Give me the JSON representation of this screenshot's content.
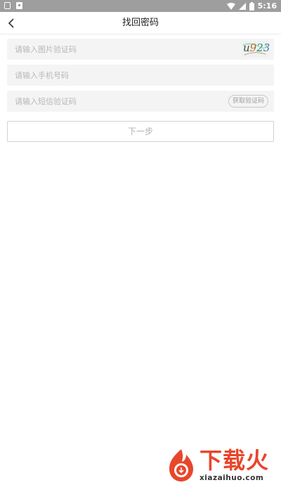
{
  "status_bar": {
    "time": "5:16"
  },
  "header": {
    "title": "找回密码"
  },
  "form": {
    "captcha": {
      "placeholder": "请输入图片验证码",
      "image_text": [
        "u",
        "9",
        "2",
        "3"
      ]
    },
    "phone": {
      "placeholder": "请输入手机号码"
    },
    "sms": {
      "placeholder": "请输入短信验证码",
      "button_label": "获取验证码"
    },
    "next_label": "下一步"
  },
  "watermark": {
    "brand": "下载火",
    "url": "xiazaihuo.com"
  },
  "colors": {
    "status_bar_bg": "#9e9e9e",
    "field_bg": "#f4f4f4",
    "watermark_red": "#e8462b"
  }
}
